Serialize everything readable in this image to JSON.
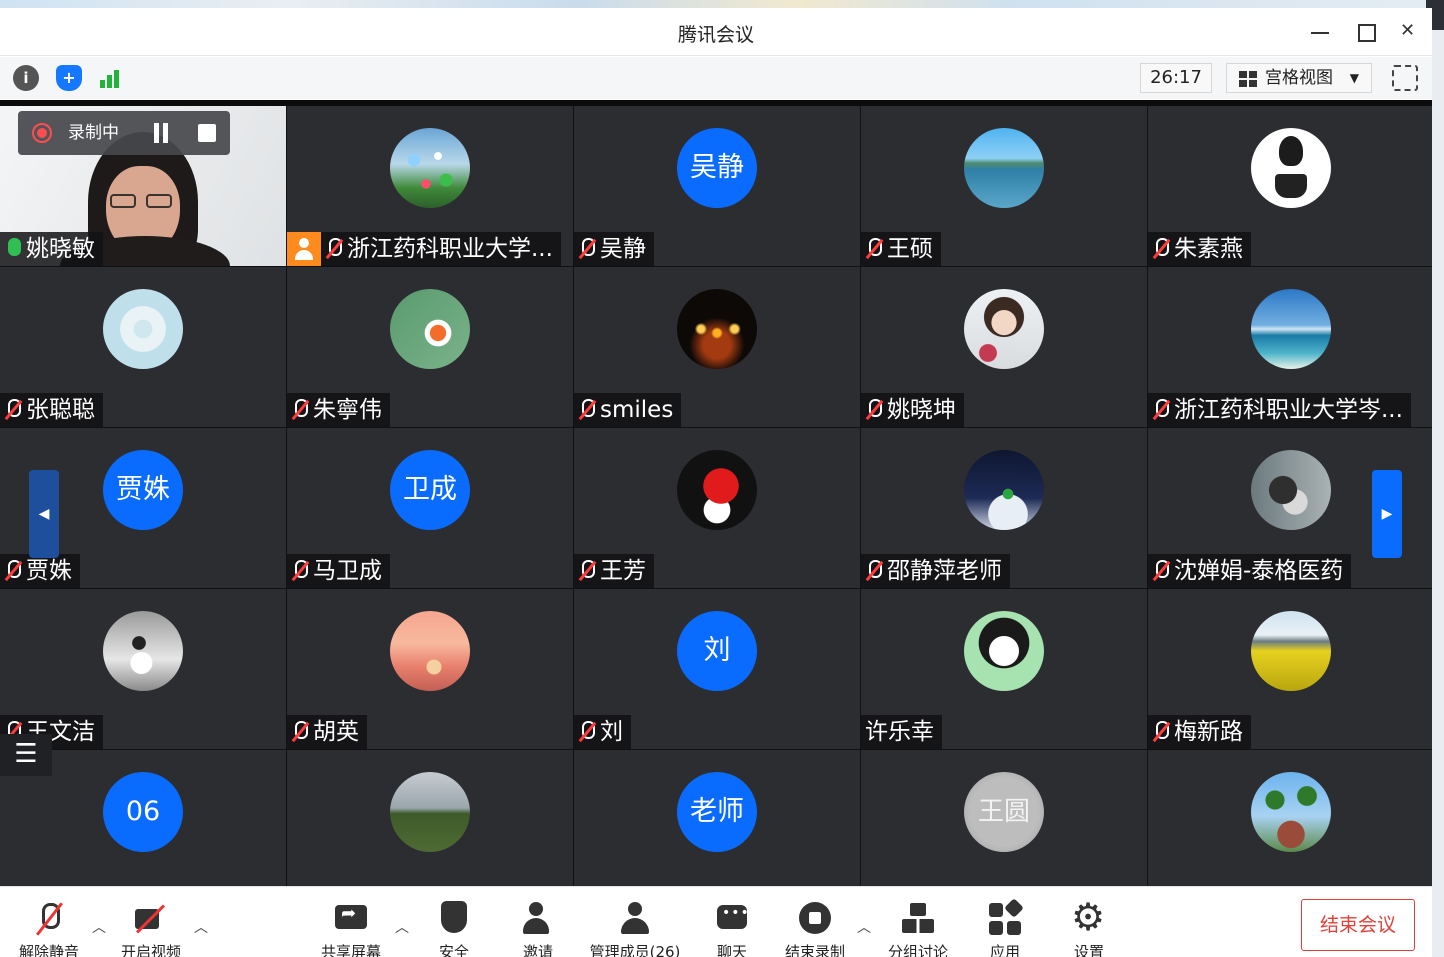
{
  "window": {
    "title": "腾讯会议"
  },
  "infobar": {
    "icons": [
      "info-icon",
      "shield-icon",
      "signal-icon"
    ],
    "timer": "26:17",
    "view_mode": "宫格视图"
  },
  "recording": {
    "label": "录制中"
  },
  "participants": [
    {
      "name": "姚晓敏",
      "avatar": "camera",
      "muted": false,
      "speaking": true
    },
    {
      "name": "浙江药科职业大学...",
      "avatar": "photo-flowers",
      "muted": true,
      "host": true
    },
    {
      "name": "吴静",
      "avatar_text": "吴静",
      "muted": true
    },
    {
      "name": "王硕",
      "avatar": "photo-sea",
      "muted": true
    },
    {
      "name": "朱素燕",
      "avatar": "photo-girl-drawing",
      "muted": true
    },
    {
      "name": "张聪聪",
      "avatar": "photo-donut",
      "muted": true
    },
    {
      "name": "朱寧伟",
      "avatar": "photo-koi",
      "muted": true
    },
    {
      "name": "smiles",
      "avatar": "photo-candles",
      "muted": true
    },
    {
      "name": "姚晓坤",
      "avatar": "photo-selfie",
      "muted": true
    },
    {
      "name": "浙江药科职业大学岑...",
      "avatar": "photo-iceberg",
      "muted": true
    },
    {
      "name": "贾姝",
      "avatar_text": "贾姝",
      "muted": true
    },
    {
      "name": "马卫成",
      "avatar_text": "卫成",
      "muted": true
    },
    {
      "name": "王芳",
      "avatar": "photo-cartoon",
      "muted": true
    },
    {
      "name": "邵静萍老师",
      "avatar": "photo-night",
      "muted": true
    },
    {
      "name": "沈婵娟-泰格医药",
      "avatar": "photo-cat",
      "muted": true
    },
    {
      "name": "王文洁",
      "avatar": "photo-bw-child",
      "muted": true
    },
    {
      "name": "胡英",
      "avatar": "photo-sunset",
      "muted": true
    },
    {
      "name": "刘",
      "avatar_text": "刘",
      "muted": true
    },
    {
      "name": "许乐幸",
      "avatar": "photo-anime",
      "muted": false
    },
    {
      "name": "梅新路",
      "avatar": "photo-field",
      "muted": true
    },
    {
      "name": "",
      "avatar_text": "06",
      "muted": true
    },
    {
      "name": "",
      "avatar": "photo-grass",
      "muted": true
    },
    {
      "name": "",
      "avatar_text": "老师",
      "muted": true
    },
    {
      "name": "",
      "avatar": "photo-seal",
      "muted": true
    },
    {
      "name": "",
      "avatar": "photo-palms",
      "muted": true
    }
  ],
  "seal_text": "王圆",
  "toolbar": {
    "unmute": "解除静音",
    "start_video": "开启视频",
    "share_screen": "共享屏幕",
    "security": "安全",
    "invite": "邀请",
    "manage_members": "管理成员(26)",
    "chat": "聊天",
    "stop_recording": "结束录制",
    "breakout": "分组讨论",
    "apps": "应用",
    "settings": "设置",
    "end_meeting": "结束会议"
  },
  "colors": {
    "avatar_blue": "#0a6cff",
    "mute_red": "#ff3b3b",
    "speaking_green": "#2fbf52",
    "host_orange": "#ff8a1d",
    "end_red": "#e0403a"
  }
}
